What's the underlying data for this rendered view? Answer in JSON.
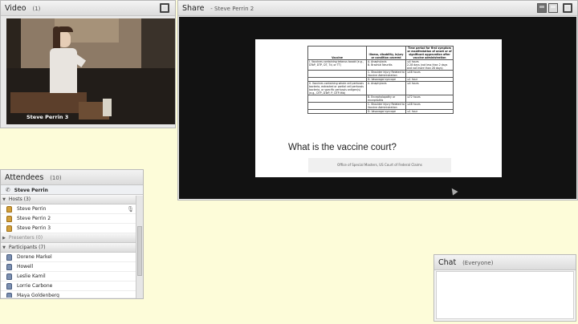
{
  "video": {
    "title": "Video",
    "count": "(1)",
    "speaker_name": "Steve Perrin 3"
  },
  "share": {
    "title": "Share",
    "presenter": "- Steve Perrin 2",
    "slide": {
      "headers": [
        "Vaccine",
        "Illness, disability, injury or condition covered",
        "Time period for first symptom or manifestation of onset or of significant aggravation after vaccine administration"
      ],
      "rows": [
        [
          "I. Vaccines containing tetanus toxoid (e.g., DTaP, DTP, DT, Td, or TT)",
          "A. Anaphylaxis\nB. Brachial Neuritis",
          "≤4 hours\n2-28 days (not less than 2 days and not more than 28 days)"
        ],
        [
          "",
          "C. Shoulder Injury Related to Vaccine Administration",
          "≤48 hours"
        ],
        [
          "",
          "D. Vasovagal syncope",
          "≤1 hour"
        ],
        [
          "II. Vaccines containing whole cell pertussis bacteria, extracted or partial cell pertussis bacteria, or specific pertussis antigen(s) (e.g., DTP, DTaP, P, DTP-Hib)",
          "A. Anaphylaxis",
          "≤4 hours"
        ],
        [
          "",
          "B. Encephalopathy or encephalitis",
          "≤72 hours"
        ],
        [
          "",
          "C. Shoulder Injury Related to Vaccine Administration",
          "≤48 hours"
        ],
        [
          "",
          "D. Vasovagal syncope",
          "≤1 hour"
        ]
      ],
      "title": "What is the vaccine court?",
      "footer": "Office of Special Masters, US Court of Federal Claims"
    }
  },
  "attendees": {
    "title": "Attendees",
    "count": "(10)",
    "current_user": "Steve Perrin",
    "hosts_label": "Hosts (3)",
    "hosts": [
      "Steve Perrin",
      "Steve Perrin 2",
      "Steve Perrin 3"
    ],
    "presenters_label": "Presenters (0)",
    "participants_label": "Participants (7)",
    "participants": [
      "Dorene Markel",
      "Howell",
      "Leslie Kamil",
      "Lorrie Carbone",
      "Maya Goldenberg"
    ]
  },
  "chat": {
    "title": "Chat",
    "audience": "(Everyone)"
  },
  "icons": {
    "fullscreen": "fullscreen-icon",
    "layout": "layout-icon",
    "host": "host-user-icon",
    "participant": "participant-user-icon",
    "phone": "phone-icon",
    "mic": "microphone-icon"
  }
}
